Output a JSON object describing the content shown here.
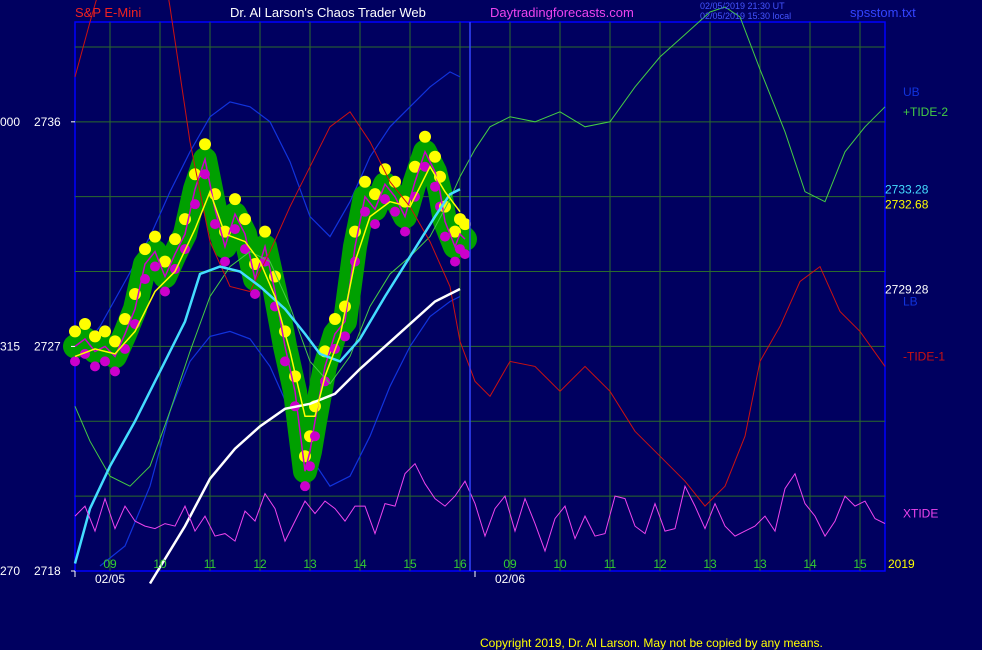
{
  "header": {
    "symbol": "S&P E-Mini",
    "brand": "Dr. Al Larson's Chaos Trader Web",
    "site": "Daytradingforecasts.com",
    "timestamp_1": "02/05/2019 21:30 UT",
    "timestamp_2": "02/05/2019 15:30 local",
    "file": "spsstom.txt"
  },
  "footer": {
    "copyright": "Copyright 2019, Dr. Al Larson. May not be copied by any means."
  },
  "colors": {
    "background": "#000060",
    "plot_frame": "#0000ff",
    "grid": "#2b6b2b",
    "price_fill": "#00a000",
    "price_yellow": "#ffff00",
    "price_magenta": "#cc00cc",
    "cyan_ma": "#44ddff",
    "white_ma": "#ffffff",
    "tide_green": "#44cc44",
    "tide_red": "#cc1111",
    "band_blue": "#1133dd",
    "xtide": "#ee44ee"
  },
  "chart_data": {
    "type": "line",
    "ylim": [
      2718,
      2740
    ],
    "y_ticks": [
      {
        "value": 2736,
        "label": "2736",
        "left_label": "000"
      },
      {
        "value": 2727,
        "label": "2727",
        "left_label": "315"
      },
      {
        "value": 2718,
        "label": "2718",
        "left_label": "270"
      }
    ],
    "x_range": [
      8.3,
      24.5
    ],
    "x_ticks": [
      {
        "x": 9,
        "label": "09"
      },
      {
        "x": 10,
        "label": "10"
      },
      {
        "x": 11,
        "label": "11"
      },
      {
        "x": 12,
        "label": "12"
      },
      {
        "x": 13,
        "label": "13"
      },
      {
        "x": 14,
        "label": "14"
      },
      {
        "x": 15,
        "label": "15"
      },
      {
        "x": 16,
        "label": "16"
      },
      {
        "x": 17,
        "label": "09"
      },
      {
        "x": 18,
        "label": "10"
      },
      {
        "x": 19,
        "label": "11"
      },
      {
        "x": 20,
        "label": "12"
      },
      {
        "x": 21,
        "label": "13"
      },
      {
        "x": 22,
        "label": "13"
      },
      {
        "x": 23,
        "label": "14"
      },
      {
        "x": 24,
        "label": "15"
      },
      {
        "x": 25,
        "label": "13"
      }
    ],
    "date_labels": [
      {
        "x": 8.3,
        "label": "02/05"
      },
      {
        "x": 16.3,
        "label": "02/06"
      }
    ],
    "year_label": "2019",
    "now_x": 16.2,
    "right_labels": [
      {
        "text": "UB",
        "value": 2737.2,
        "color": "#1133dd"
      },
      {
        "text": "+TIDE-2",
        "value": 2736.4,
        "color": "#44cc44"
      },
      {
        "text": "2733.28",
        "value": 2733.28,
        "color": "#44ddff"
      },
      {
        "text": "2732.68",
        "value": 2732.68,
        "color": "#ffff00"
      },
      {
        "text": "2729.28",
        "value": 2729.28,
        "color": "#ffffff"
      },
      {
        "text": "LB",
        "value": 2728.8,
        "color": "#1133dd"
      },
      {
        "text": "-TIDE-1",
        "value": 2726.6,
        "color": "#cc1111"
      },
      {
        "text": "XTIDE",
        "value": 2720.3,
        "color": "#ee44ee"
      }
    ],
    "series": [
      {
        "key": "price",
        "x": [
          8.3,
          8.5,
          8.7,
          8.9,
          9.1,
          9.3,
          9.5,
          9.7,
          9.9,
          10.1,
          10.3,
          10.5,
          10.7,
          10.9,
          11.1,
          11.3,
          11.5,
          11.7,
          11.9,
          12.1,
          12.3,
          12.5,
          12.7,
          12.9,
          13.0,
          13.1,
          13.3,
          13.5,
          13.7,
          13.9,
          14.1,
          14.3,
          14.5,
          14.7,
          14.9,
          15.1,
          15.3,
          15.5,
          15.6,
          15.7,
          15.9,
          16.0,
          16.1
        ],
        "y": [
          2727.0,
          2727.3,
          2726.8,
          2727.0,
          2726.6,
          2727.5,
          2728.5,
          2730.3,
          2730.8,
          2729.8,
          2730.7,
          2731.5,
          2733.3,
          2734.5,
          2732.5,
          2731.0,
          2732.3,
          2731.5,
          2729.7,
          2731.0,
          2729.2,
          2727.0,
          2725.2,
          2722.0,
          2722.8,
          2724.0,
          2726.2,
          2727.5,
          2728.0,
          2731.0,
          2733.0,
          2732.5,
          2733.5,
          2733.0,
          2732.2,
          2733.6,
          2734.8,
          2734.0,
          2733.2,
          2732.0,
          2731.0,
          2731.5,
          2731.3
        ]
      },
      {
        "key": "yellow_avg",
        "x": [
          8.3,
          8.7,
          9.1,
          9.5,
          9.9,
          10.3,
          10.7,
          11.0,
          11.3,
          11.7,
          12.0,
          12.3,
          12.6,
          12.9,
          13.1,
          13.3,
          13.6,
          13.9,
          14.2,
          14.6,
          15.0,
          15.4,
          15.7,
          16.0
        ],
        "y": [
          2726.6,
          2726.9,
          2726.7,
          2727.6,
          2729.2,
          2730.0,
          2731.7,
          2733.2,
          2731.5,
          2731.2,
          2730.4,
          2729.0,
          2726.8,
          2724.2,
          2724.2,
          2725.8,
          2727.4,
          2730.4,
          2732.2,
          2732.8,
          2732.6,
          2734.2,
          2733.2,
          2732.4
        ]
      },
      {
        "key": "cyan_ma",
        "x": [
          8.3,
          8.6,
          9.0,
          9.5,
          10.0,
          10.5,
          10.8,
          11.2,
          11.6,
          12.0,
          12.5,
          12.9,
          13.2,
          13.6,
          14.0,
          14.5,
          15.0,
          15.5,
          15.8,
          16.0
        ],
        "y": [
          2718.3,
          2720.5,
          2722.2,
          2724.0,
          2726.0,
          2728.0,
          2729.9,
          2730.2,
          2730.0,
          2729.4,
          2728.5,
          2727.5,
          2726.7,
          2726.4,
          2727.3,
          2729.0,
          2730.6,
          2732.2,
          2733.1,
          2733.3
        ]
      },
      {
        "key": "white_ma",
        "x": [
          9.8,
          10.5,
          11.0,
          11.5,
          12.0,
          12.5,
          13.0,
          13.5,
          14.0,
          14.5,
          15.0,
          15.5,
          16.0
        ],
        "y": [
          2717.5,
          2719.8,
          2721.7,
          2722.9,
          2723.8,
          2724.5,
          2724.7,
          2725.1,
          2726.1,
          2727.0,
          2727.9,
          2728.8,
          2729.3
        ]
      },
      {
        "key": "upper_band",
        "x": [
          8.3,
          8.8,
          9.3,
          9.8,
          10.2,
          10.6,
          11.0,
          11.4,
          11.8,
          12.2,
          12.6,
          13.0,
          13.4,
          13.8,
          14.2,
          14.6,
          15.0,
          15.4,
          15.8,
          16.0
        ],
        "y": [
          2726.5,
          2727.8,
          2729.6,
          2731.4,
          2733.2,
          2734.8,
          2736.2,
          2736.8,
          2736.6,
          2736.0,
          2734.4,
          2732.2,
          2731.4,
          2732.8,
          2734.6,
          2735.8,
          2736.6,
          2737.4,
          2738.0,
          2737.8
        ]
      },
      {
        "key": "lower_band",
        "x": [
          8.8,
          9.3,
          9.8,
          10.2,
          10.6,
          11.0,
          11.4,
          11.8,
          12.2,
          12.6,
          13.0,
          13.4,
          13.8,
          14.2,
          14.6,
          15.0,
          15.4,
          15.8,
          16.0
        ],
        "y": [
          2718.2,
          2719.0,
          2721.4,
          2724.4,
          2726.4,
          2727.4,
          2727.6,
          2727.3,
          2726.2,
          2724.4,
          2722.6,
          2721.4,
          2721.8,
          2723.4,
          2725.4,
          2727.0,
          2728.2,
          2728.8,
          2729.0
        ]
      },
      {
        "key": "tide_green",
        "x": [
          8.3,
          8.6,
          9.0,
          9.4,
          9.8,
          10.2,
          10.6,
          11.0,
          11.4,
          11.8,
          12.2,
          12.6,
          13.0,
          13.4,
          13.8,
          14.2,
          14.6,
          15.0,
          15.4,
          15.8,
          16.0,
          16.3,
          16.6,
          17.0,
          17.5,
          18.0,
          18.5,
          19.0,
          19.5,
          20.0,
          20.5,
          21.0,
          21.3,
          21.6,
          22.0,
          22.5,
          22.9,
          23.3,
          23.7,
          24.1,
          24.5
        ],
        "y": [
          2724.6,
          2723.2,
          2721.8,
          2721.4,
          2722.2,
          2724.4,
          2726.8,
          2729.0,
          2730.2,
          2730.8,
          2730.4,
          2728.6,
          2726.4,
          2725.5,
          2726.6,
          2728.6,
          2729.9,
          2730.6,
          2731.4,
          2732.9,
          2733.8,
          2734.9,
          2735.8,
          2736.2,
          2736.0,
          2736.4,
          2735.8,
          2736.0,
          2737.4,
          2738.6,
          2739.5,
          2740.4,
          2740.6,
          2740.2,
          2738.1,
          2735.6,
          2733.2,
          2732.8,
          2734.8,
          2735.8,
          2736.6
        ]
      },
      {
        "key": "tide_red",
        "x": [
          8.3,
          8.6,
          9.0,
          9.4,
          9.8,
          10.2,
          10.6,
          11.0,
          11.4,
          11.8,
          12.2,
          12.6,
          13.0,
          13.4,
          13.8,
          14.2,
          14.6,
          15.0,
          15.4,
          15.8,
          16.0,
          16.3,
          16.6,
          17.0,
          17.5,
          18.0,
          18.5,
          19.0,
          19.5,
          20.0,
          20.5,
          20.9,
          21.3,
          21.7,
          22.0,
          22.4,
          22.8,
          23.2,
          23.6,
          24.0,
          24.5
        ],
        "y": [
          2737.8,
          2740.0,
          2742.8,
          2744.6,
          2745.4,
          2740.6,
          2735.2,
          2731.2,
          2729.4,
          2729.2,
          2730.8,
          2732.6,
          2734.2,
          2735.8,
          2736.4,
          2735.2,
          2733.6,
          2732.6,
          2731.2,
          2729.4,
          2727.2,
          2725.6,
          2725.0,
          2726.4,
          2726.2,
          2725.2,
          2726.2,
          2725.2,
          2723.6,
          2722.6,
          2721.6,
          2720.6,
          2721.4,
          2723.4,
          2726.4,
          2727.8,
          2729.6,
          2730.2,
          2728.4,
          2727.6,
          2726.2
        ]
      },
      {
        "key": "xtide",
        "x": [
          8.3,
          8.5,
          8.7,
          8.9,
          9.1,
          9.3,
          9.5,
          9.7,
          9.9,
          10.1,
          10.3,
          10.5,
          10.7,
          10.9,
          11.1,
          11.3,
          11.5,
          11.7,
          11.9,
          12.1,
          12.3,
          12.5,
          12.7,
          12.9,
          13.1,
          13.3,
          13.5,
          13.7,
          13.9,
          14.1,
          14.3,
          14.5,
          14.7,
          14.9,
          15.1,
          15.3,
          15.5,
          15.7,
          15.9,
          16.1,
          16.3,
          16.5,
          16.7,
          16.9,
          17.1,
          17.3,
          17.5,
          17.7,
          17.9,
          18.1,
          18.3,
          18.5,
          18.7,
          18.9,
          19.1,
          19.3,
          19.5,
          19.7,
          19.9,
          20.1,
          20.3,
          20.5,
          20.7,
          20.9,
          21.1,
          21.3,
          21.5,
          21.7,
          21.9,
          22.1,
          22.3,
          22.5,
          22.7,
          22.9,
          23.1,
          23.3,
          23.5,
          23.7,
          23.9,
          24.1,
          24.3,
          24.5
        ],
        "y": [
          2720.2,
          2720.6,
          2719.6,
          2720.9,
          2719.7,
          2720.6,
          2720.0,
          2719.8,
          2719.7,
          2719.9,
          2719.8,
          2720.6,
          2719.6,
          2720.2,
          2719.4,
          2719.5,
          2719.2,
          2720.4,
          2720.0,
          2721.1,
          2720.5,
          2719.2,
          2720.0,
          2720.8,
          2720.3,
          2720.8,
          2720.5,
          2720.0,
          2720.6,
          2720.6,
          2719.5,
          2720.7,
          2720.6,
          2721.9,
          2722.3,
          2721.5,
          2720.9,
          2720.6,
          2721.0,
          2721.6,
          2720.7,
          2719.4,
          2720.5,
          2721.0,
          2719.6,
          2720.9,
          2719.9,
          2718.8,
          2720.1,
          2720.6,
          2719.3,
          2720.2,
          2719.4,
          2719.5,
          2721.0,
          2720.9,
          2719.8,
          2719.5,
          2720.7,
          2719.6,
          2719.7,
          2721.4,
          2720.6,
          2719.7,
          2720.7,
          2719.8,
          2719.4,
          2719.6,
          2719.8,
          2720.2,
          2719.6,
          2721.3,
          2721.9,
          2720.7,
          2720.2,
          2719.4,
          2720.0,
          2721.0,
          2720.6,
          2720.8,
          2720.1,
          2719.9
        ]
      }
    ]
  }
}
